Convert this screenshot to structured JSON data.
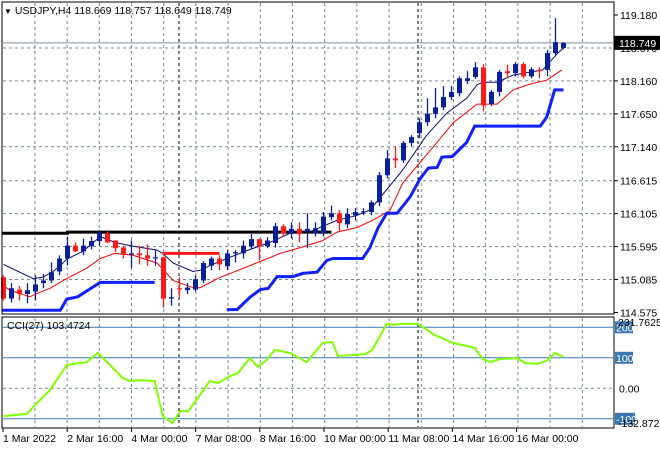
{
  "header": {
    "symbol": "USDJPY,H4",
    "open": "118.669",
    "high": "118.757",
    "low": "118.649",
    "close": "118.749"
  },
  "price_axis": {
    "ticks": [
      "119.180",
      "118.670",
      "118.160",
      "117.650",
      "117.140",
      "116.615",
      "116.105",
      "115.595",
      "115.085",
      "114.575"
    ],
    "current_price_label": "118.749",
    "current_price": 118.749
  },
  "cci_panel": {
    "label": "CCI(27) 103.4724",
    "max_label": "231.7625",
    "min_label": "-132.8725",
    "level_labels": [
      "200",
      "100",
      "-100"
    ],
    "levels": [
      200,
      100,
      -100
    ],
    "zero_label": "0.00",
    "values": [
      [
        0,
        -91
      ],
      [
        2.9,
        -84
      ],
      [
        4.2,
        -48
      ],
      [
        5.8,
        -6
      ],
      [
        7.9,
        76
      ],
      [
        10.4,
        86
      ],
      [
        11.8,
        116
      ],
      [
        14.9,
        34
      ],
      [
        15.8,
        24
      ],
      [
        17.1,
        27
      ],
      [
        18.9,
        24
      ],
      [
        19.9,
        -91
      ],
      [
        21.1,
        -114
      ],
      [
        22.1,
        -75
      ],
      [
        23.1,
        -75
      ],
      [
        25.8,
        24
      ],
      [
        26.8,
        17
      ],
      [
        28.3,
        40
      ],
      [
        29.3,
        50
      ],
      [
        30.8,
        99
      ],
      [
        31.8,
        70
      ],
      [
        32.9,
        93
      ],
      [
        33.9,
        126
      ],
      [
        35.8,
        116
      ],
      [
        37.9,
        86
      ],
      [
        39.9,
        149
      ],
      [
        41.1,
        152
      ],
      [
        41.8,
        106
      ],
      [
        43.6,
        109
      ],
      [
        45.2,
        112
      ],
      [
        46.1,
        126
      ],
      [
        47.9,
        211
      ],
      [
        48.6,
        208
      ],
      [
        49.9,
        211
      ],
      [
        51.8,
        211
      ],
      [
        53.9,
        175
      ],
      [
        56.1,
        149
      ],
      [
        57.9,
        139
      ],
      [
        58.9,
        132
      ],
      [
        59.9,
        96
      ],
      [
        60.8,
        86
      ],
      [
        62.1,
        96
      ],
      [
        64.2,
        99
      ],
      [
        65.2,
        83
      ],
      [
        66.8,
        80
      ],
      [
        68.1,
        93
      ],
      [
        68.9,
        116
      ],
      [
        70,
        103.47
      ]
    ]
  },
  "time_axis": {
    "labels": [
      "1 Mar 2022",
      "2 Mar 16:00",
      "4 Mar 00:00",
      "7 Mar 08:00",
      "8 Mar 16:00",
      "10 Mar 00:00",
      "11 Mar 08:00",
      "14 Mar 16:00",
      "16 Mar 00:00"
    ]
  },
  "colors": {
    "bull": "#0a1fa0",
    "bear": "#ff1a1a",
    "fast_ma": "#0b0b6e",
    "slow_ma": "#ff0000",
    "step_line": "#1020ff",
    "level_line": "#000000",
    "cci_line": "#7fff00",
    "cci_level": "#3a78b0"
  },
  "candles": [
    [
      115.12,
      115.15,
      114.76,
      114.79
    ],
    [
      114.79,
      115.03,
      114.73,
      114.95
    ],
    [
      114.93,
      114.99,
      114.76,
      114.86
    ],
    [
      114.86,
      115.03,
      114.72,
      114.92
    ],
    [
      114.9,
      115.15,
      114.76,
      115.01
    ],
    [
      115.03,
      115.17,
      114.95,
      115.07
    ],
    [
      115.07,
      115.35,
      115.03,
      115.2
    ],
    [
      115.21,
      115.46,
      115.15,
      115.41
    ],
    [
      115.41,
      115.75,
      115.3,
      115.61
    ],
    [
      115.61,
      115.66,
      115.51,
      115.52
    ],
    [
      115.52,
      115.72,
      115.46,
      115.61
    ],
    [
      115.6,
      115.75,
      115.55,
      115.68
    ],
    [
      115.68,
      115.85,
      115.61,
      115.8
    ],
    [
      115.8,
      115.83,
      115.65,
      115.66
    ],
    [
      115.69,
      115.69,
      115.51,
      115.57
    ],
    [
      115.58,
      115.61,
      115.41,
      115.48
    ],
    [
      115.48,
      115.69,
      115.26,
      115.49
    ],
    [
      115.49,
      115.61,
      115.32,
      115.46
    ],
    [
      115.46,
      115.63,
      115.3,
      115.41
    ],
    [
      115.42,
      115.54,
      115.3,
      115.43
    ],
    [
      115.43,
      115.43,
      114.65,
      114.79
    ],
    [
      114.79,
      114.95,
      114.68,
      114.81
    ],
    [
      114.95,
      115.12,
      114.81,
      114.93
    ],
    [
      114.92,
      115.03,
      114.86,
      114.96
    ],
    [
      114.93,
      115.15,
      114.9,
      115.09
    ],
    [
      115.07,
      115.37,
      115.03,
      115.34
    ],
    [
      115.3,
      115.44,
      115.23,
      115.41
    ],
    [
      115.41,
      115.46,
      115.23,
      115.32
    ],
    [
      115.29,
      115.54,
      115.23,
      115.49
    ],
    [
      115.49,
      115.54,
      115.35,
      115.51
    ],
    [
      115.49,
      115.69,
      115.41,
      115.61
    ],
    [
      115.6,
      115.79,
      115.55,
      115.71
    ],
    [
      115.71,
      115.72,
      115.38,
      115.6
    ],
    [
      115.6,
      115.74,
      115.57,
      115.69
    ],
    [
      115.65,
      115.96,
      115.58,
      115.91
    ],
    [
      115.91,
      115.94,
      115.75,
      115.8
    ],
    [
      115.79,
      115.97,
      115.72,
      115.87
    ],
    [
      115.87,
      115.97,
      115.66,
      115.79
    ],
    [
      115.83,
      116.11,
      115.57,
      115.87
    ],
    [
      115.8,
      115.97,
      115.75,
      115.88
    ],
    [
      115.8,
      116.13,
      115.75,
      116.06
    ],
    [
      116.05,
      116.23,
      116.0,
      116.11
    ],
    [
      116.11,
      116.16,
      115.82,
      115.96
    ],
    [
      115.94,
      116.19,
      115.88,
      116.1
    ],
    [
      116.08,
      116.19,
      116.0,
      116.13
    ],
    [
      116.13,
      116.19,
      116.08,
      116.14
    ],
    [
      116.13,
      116.31,
      116.08,
      116.28
    ],
    [
      116.28,
      116.75,
      116.22,
      116.7
    ],
    [
      116.7,
      117.09,
      116.65,
      116.96
    ],
    [
      116.96,
      117.15,
      116.81,
      116.93
    ],
    [
      116.93,
      117.23,
      116.89,
      117.2
    ],
    [
      117.2,
      117.32,
      117.15,
      117.29
    ],
    [
      117.35,
      117.58,
      117.27,
      117.52
    ],
    [
      117.52,
      117.89,
      117.46,
      117.65
    ],
    [
      117.65,
      118.05,
      117.58,
      117.75
    ],
    [
      117.75,
      118.08,
      117.71,
      117.91
    ],
    [
      117.91,
      118.08,
      117.86,
      117.99
    ],
    [
      117.97,
      118.23,
      117.92,
      118.2
    ],
    [
      118.16,
      118.31,
      118.11,
      118.2
    ],
    [
      118.22,
      118.45,
      118.19,
      118.37
    ],
    [
      118.37,
      118.42,
      117.69,
      117.78
    ],
    [
      117.8,
      118.02,
      117.77,
      117.99
    ],
    [
      117.99,
      118.33,
      117.92,
      118.3
    ],
    [
      118.31,
      118.41,
      118.2,
      118.28
    ],
    [
      118.28,
      118.45,
      118.23,
      118.42
    ],
    [
      118.42,
      118.45,
      118.2,
      118.23
    ],
    [
      118.23,
      118.37,
      118.2,
      118.34
    ],
    [
      118.33,
      118.37,
      118.2,
      118.31
    ],
    [
      118.33,
      118.64,
      118.23,
      118.59
    ],
    [
      118.59,
      119.13,
      118.56,
      118.76
    ],
    [
      118.669,
      118.757,
      118.649,
      118.749
    ]
  ],
  "fast_ma": [
    [
      0,
      115.32
    ],
    [
      3.7,
      115.1
    ],
    [
      4.9,
      115.12
    ],
    [
      6.1,
      115.2
    ],
    [
      7.1,
      115.3
    ],
    [
      7.9,
      115.4
    ],
    [
      9.9,
      115.52
    ],
    [
      12.1,
      115.75
    ],
    [
      13.9,
      115.66
    ],
    [
      15.8,
      115.61
    ],
    [
      19.2,
      115.54
    ],
    [
      19.9,
      115.49
    ],
    [
      21.2,
      115.34
    ],
    [
      23.7,
      115.21
    ],
    [
      24.6,
      115.23
    ],
    [
      25.8,
      115.3
    ],
    [
      28.3,
      115.43
    ],
    [
      30.8,
      115.55
    ],
    [
      33.3,
      115.66
    ],
    [
      35.8,
      115.8
    ],
    [
      38.3,
      115.82
    ],
    [
      39.9,
      115.91
    ],
    [
      41.7,
      116.0
    ],
    [
      44.2,
      116.08
    ],
    [
      45.8,
      116.16
    ],
    [
      49.9,
      116.78
    ],
    [
      52.9,
      117.32
    ],
    [
      55.4,
      117.66
    ],
    [
      57.9,
      117.89
    ],
    [
      59.2,
      118.1
    ],
    [
      59.9,
      118.14
    ],
    [
      61.7,
      118.14
    ],
    [
      63.7,
      118.25
    ],
    [
      67.4,
      118.33
    ],
    [
      69.2,
      118.58
    ],
    [
      70,
      118.67
    ]
  ],
  "slow_ma": [
    [
      0,
      114.99
    ],
    [
      0.8,
      114.92
    ],
    [
      3.3,
      114.82
    ],
    [
      4.2,
      114.87
    ],
    [
      5.8,
      114.95
    ],
    [
      7.9,
      115.1
    ],
    [
      10.4,
      115.26
    ],
    [
      12.1,
      115.41
    ],
    [
      13.9,
      115.49
    ],
    [
      16.2,
      115.46
    ],
    [
      19.2,
      115.34
    ],
    [
      21.2,
      115.07
    ],
    [
      23.9,
      114.95
    ],
    [
      24.6,
      114.96
    ],
    [
      27.1,
      115.12
    ],
    [
      30.8,
      115.3
    ],
    [
      34.6,
      115.49
    ],
    [
      37.1,
      115.58
    ],
    [
      39.9,
      115.69
    ],
    [
      41.7,
      115.82
    ],
    [
      44.2,
      115.89
    ],
    [
      46.1,
      116.0
    ],
    [
      48.3,
      116.15
    ],
    [
      49.9,
      116.58
    ],
    [
      54.2,
      117.21
    ],
    [
      56.2,
      117.51
    ],
    [
      59.2,
      117.8
    ],
    [
      61.7,
      117.8
    ],
    [
      63.7,
      118.02
    ],
    [
      65.8,
      118.11
    ],
    [
      67.9,
      118.17
    ],
    [
      69.8,
      118.33
    ]
  ],
  "step_lines": [
    [
      [
        -0.2,
        114.61
      ],
      [
        7.1,
        114.61
      ],
      [
        7.9,
        114.78
      ],
      [
        9.3,
        114.82
      ],
      [
        12.1,
        115.04
      ],
      [
        18.9,
        115.04
      ]
    ],
    [
      [
        27.9,
        114.62
      ],
      [
        29.2,
        114.62
      ],
      [
        30.8,
        114.81
      ],
      [
        32.1,
        114.93
      ],
      [
        33.1,
        114.95
      ],
      [
        34.2,
        115.13
      ],
      [
        36.2,
        115.13
      ],
      [
        37.4,
        115.18
      ],
      [
        39.2,
        115.2
      ],
      [
        40.4,
        115.38
      ],
      [
        41.2,
        115.41
      ],
      [
        44.9,
        115.41
      ],
      [
        45.8,
        115.58
      ],
      [
        46.8,
        115.88
      ],
      [
        47.9,
        116.11
      ],
      [
        49.2,
        116.11
      ],
      [
        50.8,
        116.36
      ],
      [
        52.1,
        116.65
      ],
      [
        53.1,
        116.81
      ],
      [
        54.2,
        116.82
      ],
      [
        54.8,
        116.98
      ],
      [
        56.1,
        116.99
      ],
      [
        57.9,
        117.21
      ],
      [
        58.9,
        117.46
      ],
      [
        67.1,
        117.46
      ],
      [
        67.9,
        117.6
      ],
      [
        68.9,
        118.02
      ],
      [
        70,
        118.02
      ]
    ]
  ],
  "level_lines": [
    {
      "kind": "black",
      "points": [
        [
          -0.2,
          115.8
        ],
        [
          8,
          115.8
        ],
        [
          8,
          115.82
        ],
        [
          41,
          115.82
        ]
      ]
    },
    {
      "kind": "red",
      "points": [
        [
          19.9,
          115.49
        ],
        [
          27,
          115.49
        ]
      ]
    }
  ]
}
